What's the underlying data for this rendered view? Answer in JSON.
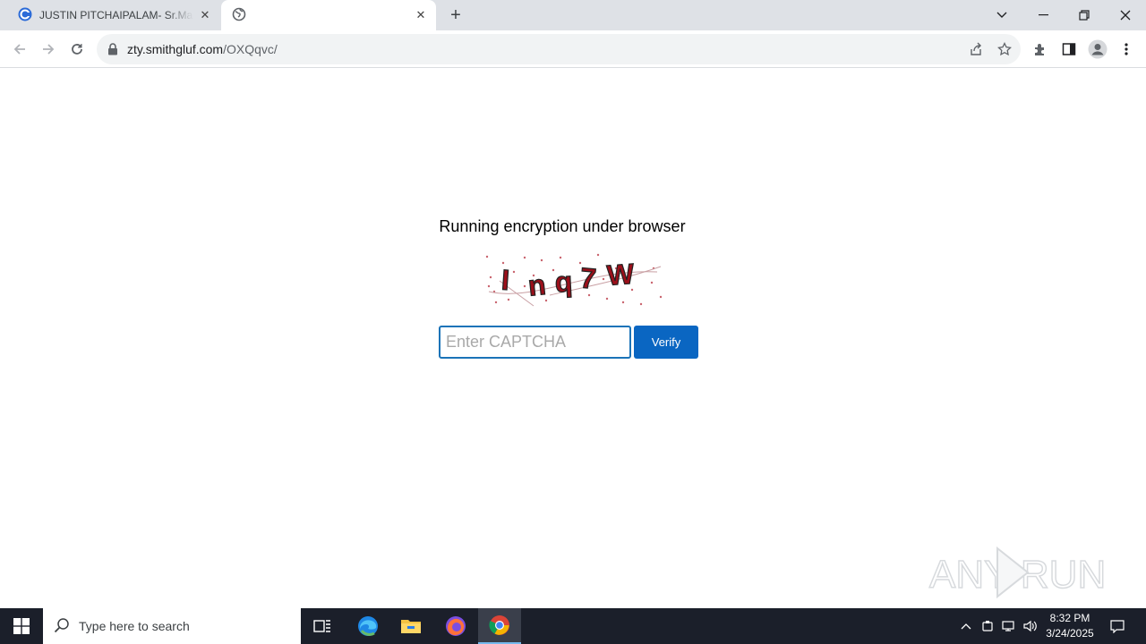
{
  "browser": {
    "tabs": [
      {
        "title": "JUSTIN PITCHAIPALAM- Sr.Manager",
        "active": false
      },
      {
        "title": "",
        "active": true
      }
    ],
    "url_host": "zty.smithgluf.com",
    "url_path": "/OXQqvc/"
  },
  "page": {
    "heading": "Running encryption under browser",
    "captcha_text": "I n q 7 W",
    "captcha_chars": [
      "I",
      "n",
      "q",
      "7",
      "W"
    ],
    "input_placeholder": "Enter CAPTCHA",
    "verify_label": "Verify"
  },
  "watermark": "ANY RUN",
  "taskbar": {
    "search_placeholder": "Type here to search",
    "time": "8:32 PM",
    "date": "3/24/2025"
  },
  "colors": {
    "accent": "#0a66c2",
    "captcha_text": "#9b0f1a",
    "taskbar": "#1b1f2a"
  }
}
